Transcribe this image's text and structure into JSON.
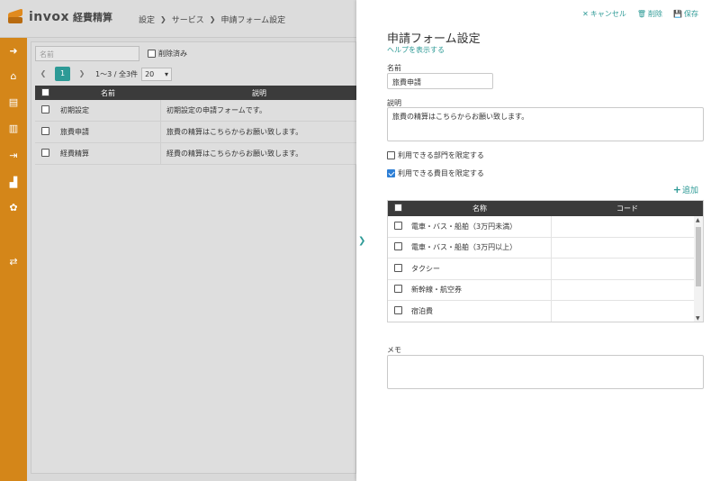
{
  "app": {
    "logo_text": "invox",
    "logo_sub": "経費精算"
  },
  "breadcrumb": [
    "設定",
    "サービス",
    "申請フォーム設定"
  ],
  "sidebar": {
    "icons": [
      "arrow-right-circle-icon",
      "home-icon",
      "document-icon",
      "document-list-icon",
      "export-icon",
      "chart-icon",
      "gear-icon",
      "transfer-icon"
    ]
  },
  "list": {
    "filter_placeholder": "名前",
    "deleted_label": "削除済み",
    "pager": {
      "current": "1",
      "range": "1〜3 / 全3件",
      "page_size": "20"
    },
    "columns": [
      "名前",
      "説明"
    ],
    "rows": [
      {
        "name": "初期設定",
        "description": "初期設定の申請フォームです。"
      },
      {
        "name": "旅費申請",
        "description": "旅費の精算はこちらからお願い致します。"
      },
      {
        "name": "経費精算",
        "description": "経費の精算はこちらからお願い致します。"
      }
    ]
  },
  "panel": {
    "actions": {
      "cancel": "キャンセル",
      "delete": "削除",
      "save": "保存"
    },
    "title": "申請フォーム設定",
    "help_link": "ヘルプを表示する",
    "name_label": "名前",
    "name_value": "旅費申請",
    "desc_label": "説明",
    "desc_value": "旅費の精算はこちらからお願い致します。",
    "limit_dept_label": "利用できる部門を限定する",
    "limit_expense_label": "利用できる費目を限定する",
    "add_label": "追加",
    "expense_columns": [
      "名称",
      "コード"
    ],
    "expense_rows": [
      {
        "name": "電車・バス・船舶（3万円未満）",
        "code": ""
      },
      {
        "name": "電車・バス・船舶（3万円以上）",
        "code": ""
      },
      {
        "name": "タクシー",
        "code": ""
      },
      {
        "name": "新幹線・航空券",
        "code": ""
      },
      {
        "name": "宿泊費",
        "code": ""
      }
    ],
    "memo_label": "メモ",
    "memo_value": ""
  },
  "colors": {
    "sidebar": "#d48619",
    "accent": "#2d9a96",
    "table_header": "#3b3b3b"
  }
}
